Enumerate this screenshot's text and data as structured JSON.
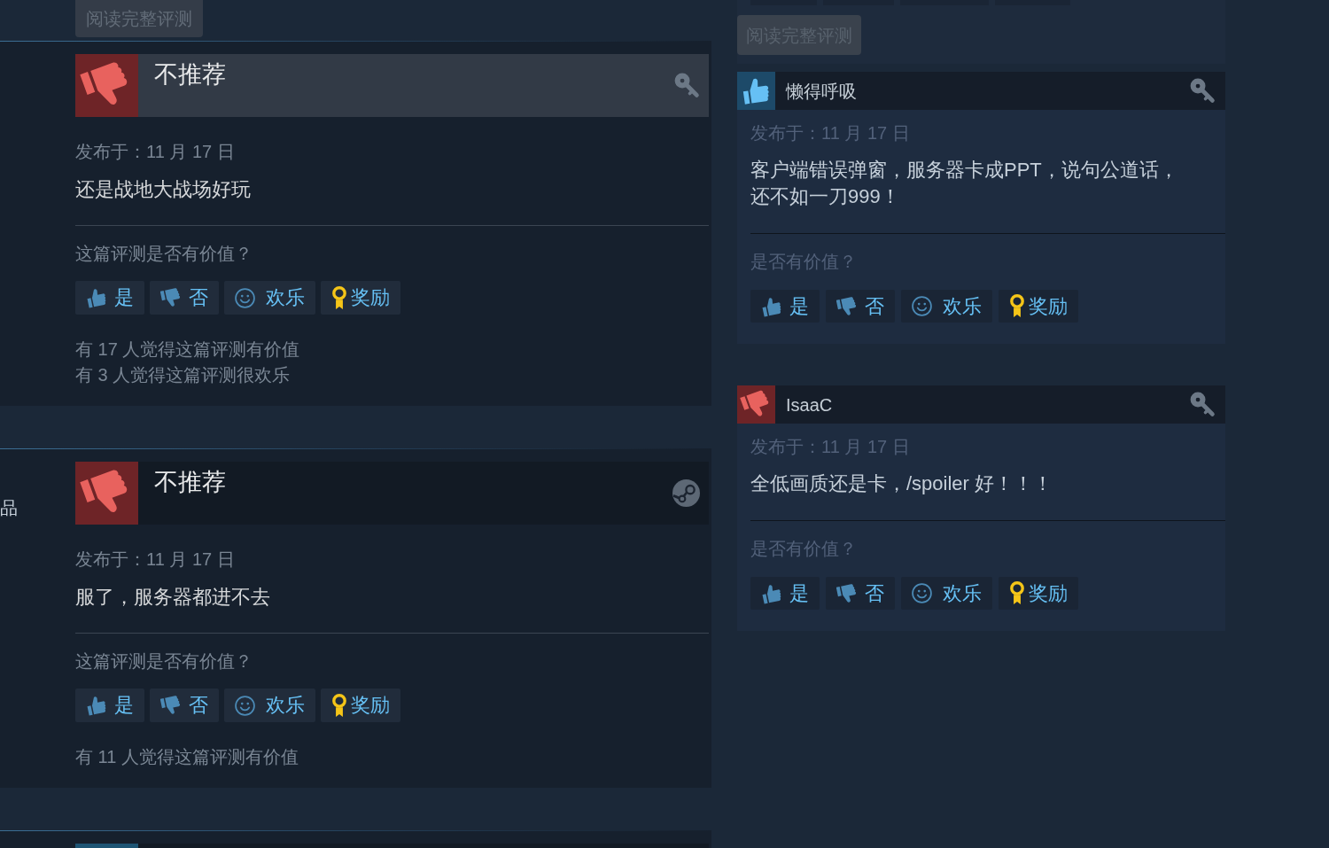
{
  "left_column": {
    "read_full_review_button": "阅读完整评测",
    "reviews": [
      {
        "kind": "key",
        "recommended": false,
        "verdict": "不推荐",
        "highlighted": true,
        "posted": "发布于：11 月 17 日",
        "text": "还是战地大战场好玩",
        "helpful_question": "这篇评测是否有价值？",
        "vote_buttons": [
          {
            "kind": "yes",
            "label": "是"
          },
          {
            "kind": "no",
            "label": "否"
          },
          {
            "kind": "funny",
            "label": "欢乐"
          },
          {
            "kind": "award",
            "label": "奖励"
          }
        ],
        "stats": [
          "有 17 人觉得这篇评测有价值",
          "有 3 人觉得这篇评测很欢乐"
        ]
      },
      {
        "kind": "steam",
        "author_fragment": "品",
        "recommended": false,
        "verdict": "不推荐",
        "highlighted": false,
        "posted": "发布于：11 月 17 日",
        "text": "服了，服务器都进不去",
        "helpful_question": "这篇评测是否有价值？",
        "vote_buttons": [
          {
            "kind": "yes",
            "label": "是"
          },
          {
            "kind": "no",
            "label": "否"
          },
          {
            "kind": "funny",
            "label": "欢乐"
          },
          {
            "kind": "award",
            "label": "奖励"
          }
        ],
        "stats": [
          "有 11 人觉得这篇评测有价值"
        ]
      }
    ],
    "next_review": {
      "recommended": true
    }
  },
  "right_column": {
    "read_full_review_button": "阅读完整评测",
    "reviews": [
      {
        "kind": "key",
        "recommended": true,
        "author": "懒得呼吸",
        "posted": "发布于：11 月 17 日",
        "text": "客户端错误弹窗，服务器卡成PPT，说句公道话，还不如一刀999！",
        "helpful_question": "是否有价值？",
        "vote_buttons": [
          {
            "kind": "yes",
            "label": "是"
          },
          {
            "kind": "no",
            "label": "否"
          },
          {
            "kind": "funny",
            "label": "欢乐"
          },
          {
            "kind": "award",
            "label": "奖励"
          }
        ]
      },
      {
        "kind": "key",
        "recommended": false,
        "author": "IsaaC",
        "posted": "发布于：11 月 17 日",
        "text": "全低画质还是卡，/spoiler 好！！！",
        "helpful_question": "是否有价值？",
        "vote_buttons": [
          {
            "kind": "yes",
            "label": "是"
          },
          {
            "kind": "no",
            "label": "否"
          },
          {
            "kind": "funny",
            "label": "欢乐"
          },
          {
            "kind": "award",
            "label": "奖励"
          }
        ]
      }
    ]
  }
}
